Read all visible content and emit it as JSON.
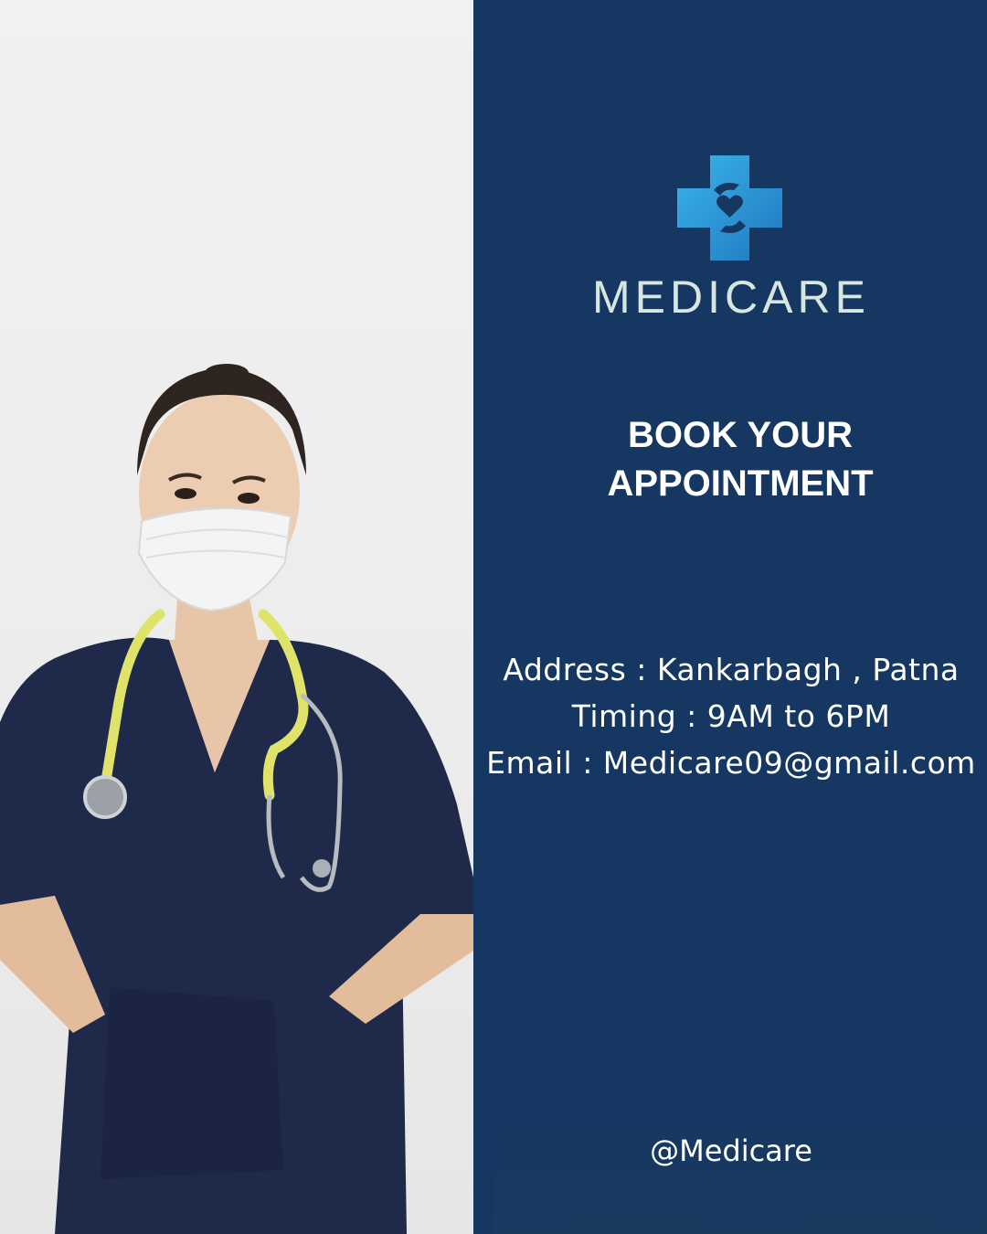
{
  "brand": {
    "logo_icon": "medical-cross-hands-heart-icon",
    "name": "MEDICARE",
    "accent_color": "#2ea3dd"
  },
  "headline": {
    "line1": "BOOK YOUR",
    "line2": "APPOINTMENT"
  },
  "contact": {
    "address": "Address : Kankarbagh , Patna",
    "timing": "Timing : 9AM to 6PM",
    "email": "Email : Medicare09@gmail.com"
  },
  "social_handle": "@Medicare",
  "colors": {
    "panel_background": "#153761",
    "brand_text": "#d8e6e1",
    "text": "#ffffff"
  }
}
